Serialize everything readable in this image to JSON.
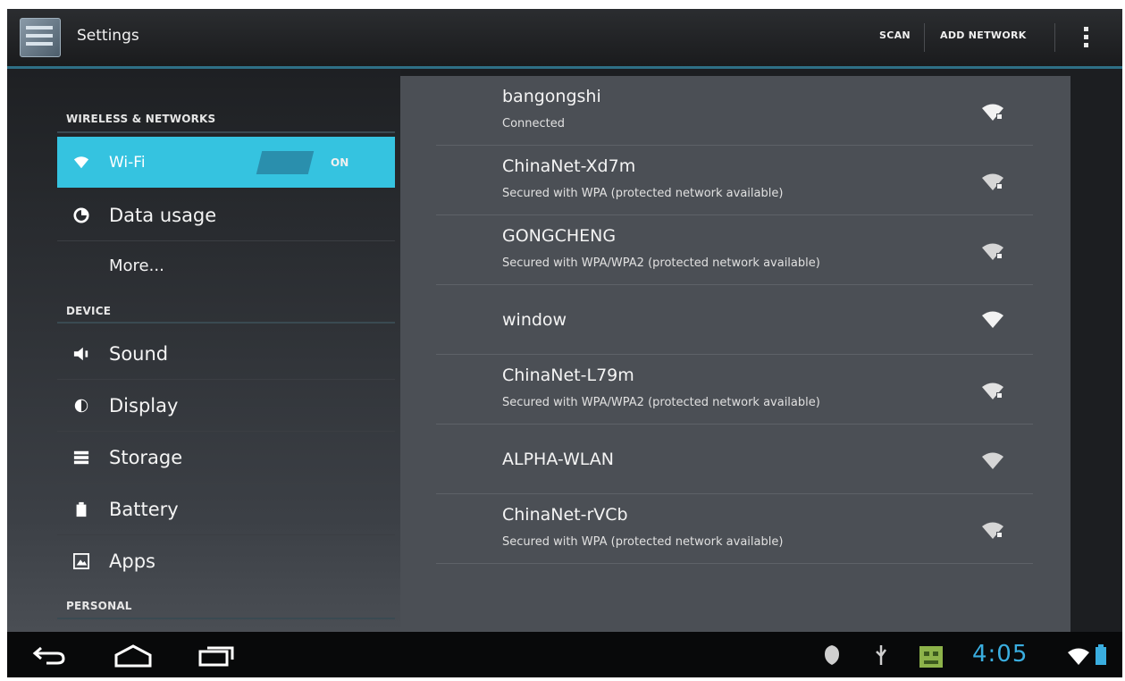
{
  "action_bar": {
    "title": "Settings",
    "scan_label": "SCAN",
    "add_network_label": "ADD NETWORK",
    "overflow_icon": "overflow-menu-icon"
  },
  "sidebar": {
    "sections": [
      {
        "header": "WIRELESS & NETWORKS"
      },
      {
        "header": "DEVICE"
      },
      {
        "header": "PERSONAL"
      }
    ],
    "items": [
      {
        "label": "Wi-Fi",
        "icon": "wifi-icon",
        "toggle": "ON",
        "selected": true
      },
      {
        "label": "Data usage",
        "icon": "data-usage-icon"
      },
      {
        "label": "More..."
      },
      {
        "label": "Sound",
        "icon": "speaker-icon"
      },
      {
        "label": "Display",
        "icon": "brightness-icon"
      },
      {
        "label": "Storage",
        "icon": "storage-icon"
      },
      {
        "label": "Battery",
        "icon": "battery-icon"
      },
      {
        "label": "Apps",
        "icon": "apps-icon"
      }
    ],
    "accent": "#35c3e0"
  },
  "networks": [
    {
      "name": "bangongshi",
      "status": "Connected",
      "secured": true
    },
    {
      "name": "ChinaNet-Xd7m",
      "status": "Secured with WPA (protected network available)",
      "secured": true
    },
    {
      "name": "GONGCHENG",
      "status": "Secured with WPA/WPA2 (protected network available)",
      "secured": true
    },
    {
      "name": "window",
      "status": "",
      "secured": false
    },
    {
      "name": "ChinaNet-L79m",
      "status": "Secured with WPA/WPA2 (protected network available)",
      "secured": true
    },
    {
      "name": "ALPHA-WLAN",
      "status": "",
      "secured": false
    },
    {
      "name": "ChinaNet-rVCb",
      "status": "Secured with WPA (protected network available)",
      "secured": true
    }
  ],
  "system_bar": {
    "back_icon": "back-icon",
    "home_icon": "home-icon",
    "recents_icon": "recent-apps-icon",
    "clock": "4:05",
    "clock_color": "#3aaee0"
  }
}
